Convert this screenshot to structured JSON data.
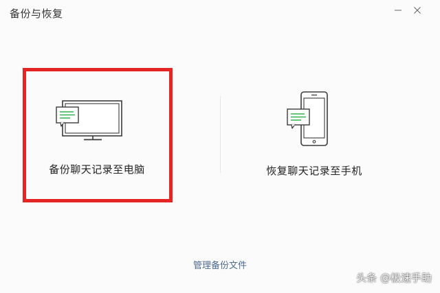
{
  "window": {
    "title": "备份与恢复"
  },
  "options": {
    "backup_to_pc": {
      "label": "备份聊天记录至电脑",
      "icon": "computer-with-chat-icon",
      "highlighted": true
    },
    "restore_to_phone": {
      "label": "恢复聊天记录至手机",
      "icon": "phone-with-chat-icon"
    }
  },
  "footer": {
    "manage_link": "管理备份文件"
  },
  "watermark": {
    "text": "头条 @极速手助"
  },
  "colors": {
    "accent_green": "#2bb34b",
    "highlight_red": "#e52424",
    "link_blue": "#4d6b94",
    "background": "#fbfbfb"
  }
}
